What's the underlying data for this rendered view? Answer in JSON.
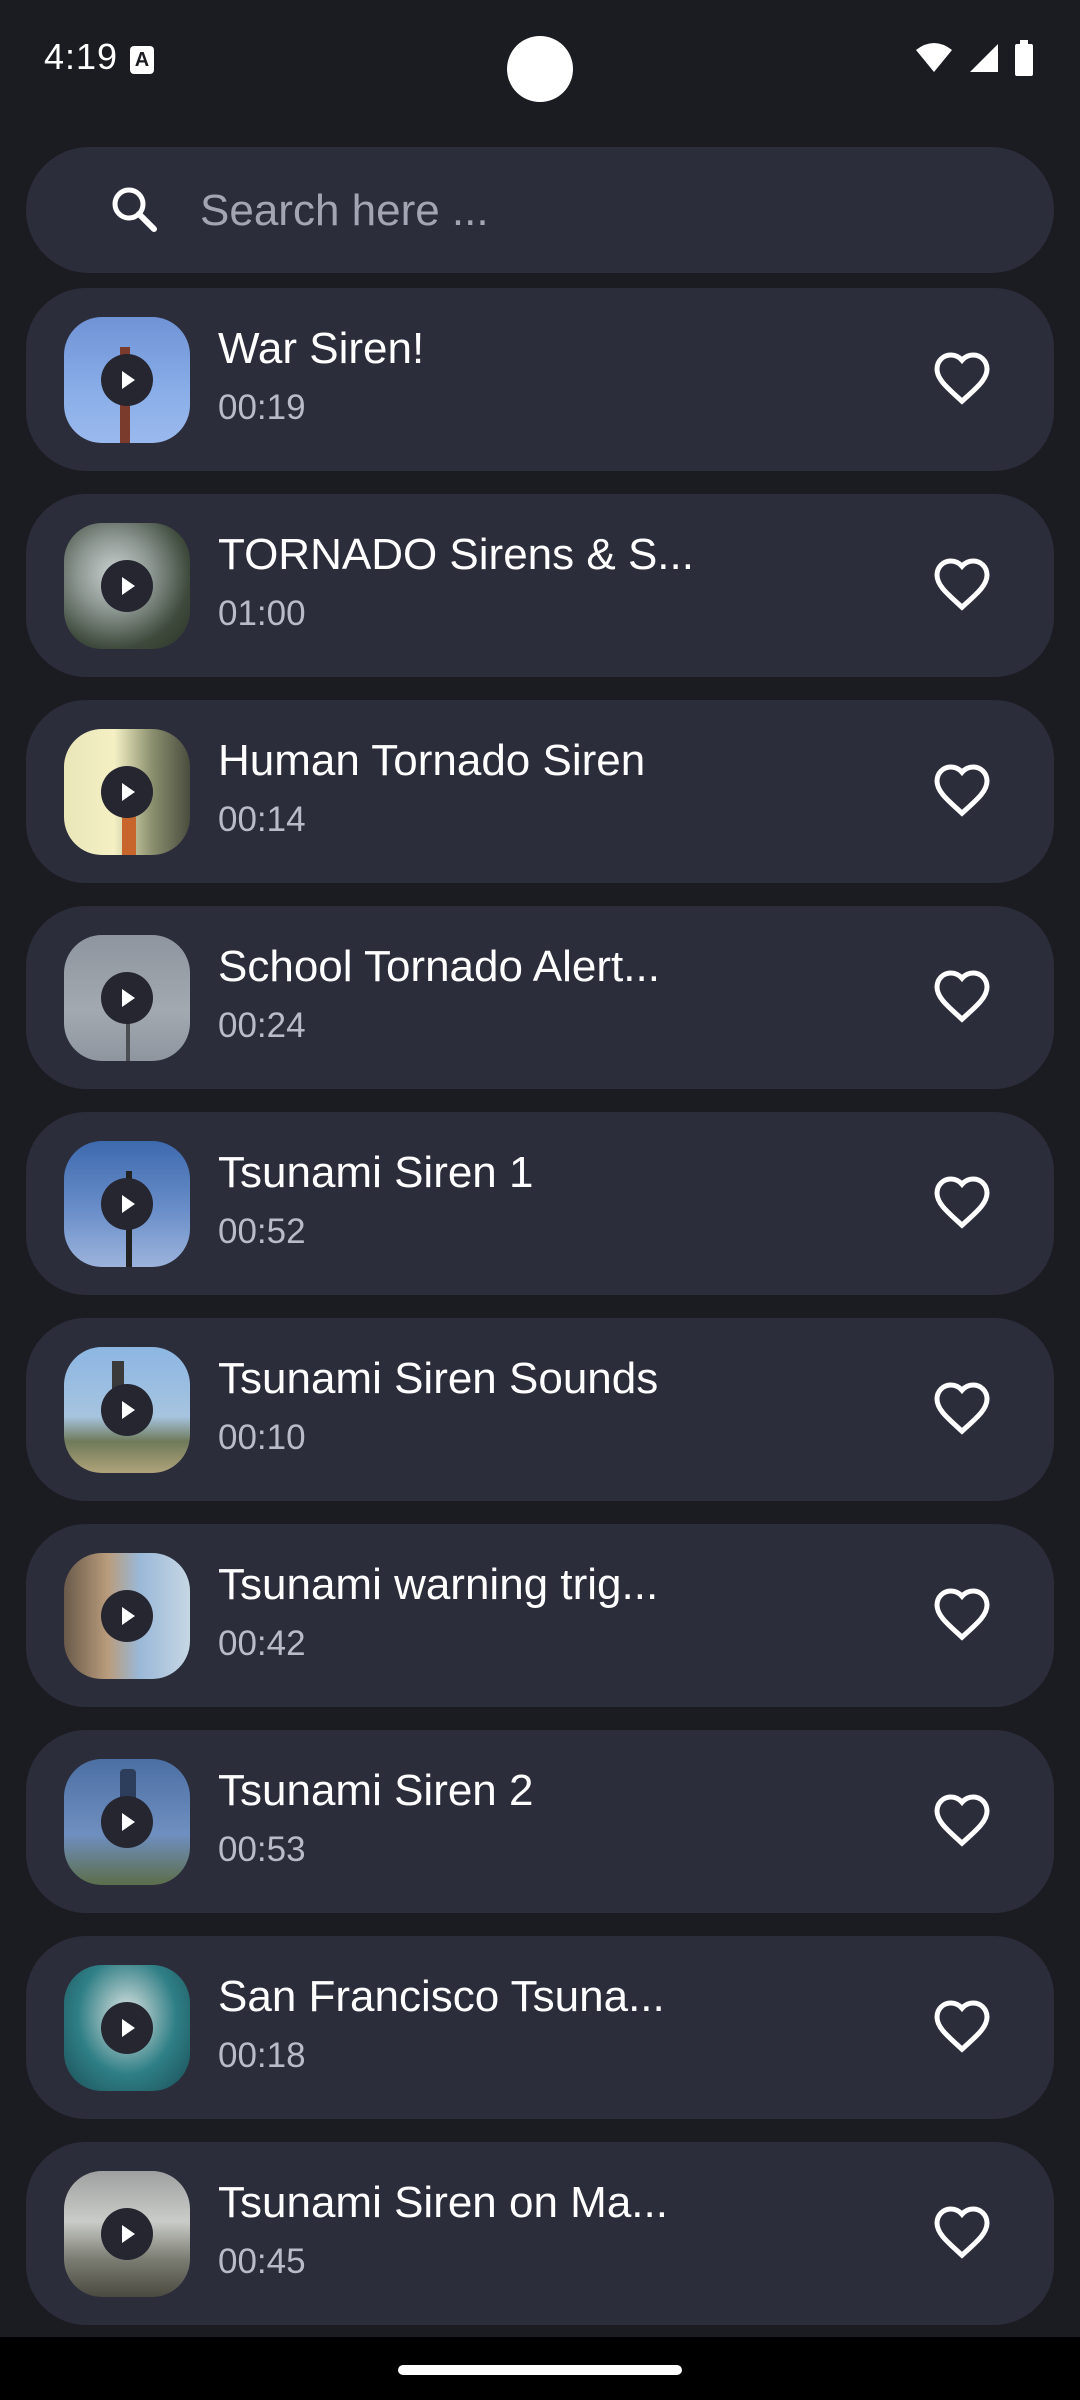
{
  "status_bar": {
    "time": "4:19",
    "notification_icon": "text-a-icon",
    "icons": [
      "wifi-icon",
      "cellular-signal-icon",
      "battery-icon"
    ]
  },
  "search": {
    "placeholder": "Search here ...",
    "value": "",
    "icon": "search-icon"
  },
  "items": [
    {
      "title": "War Siren!",
      "duration": "00:19",
      "favorited": false
    },
    {
      "title": "TORNADO Sirens & S...",
      "duration": "01:00",
      "favorited": false
    },
    {
      "title": "Human Tornado Siren",
      "duration": "00:14",
      "favorited": false
    },
    {
      "title": "School Tornado Alert...",
      "duration": "00:24",
      "favorited": false
    },
    {
      "title": "Tsunami Siren 1",
      "duration": "00:52",
      "favorited": false
    },
    {
      "title": "Tsunami Siren Sounds",
      "duration": "00:10",
      "favorited": false
    },
    {
      "title": "Tsunami warning trig...",
      "duration": "00:42",
      "favorited": false
    },
    {
      "title": "Tsunami Siren 2",
      "duration": "00:53",
      "favorited": false
    },
    {
      "title": "San Francisco Tsuna...",
      "duration": "00:18",
      "favorited": false
    },
    {
      "title": "Tsunami Siren on Ma...",
      "duration": "00:45",
      "favorited": false
    }
  ],
  "colors": {
    "background": "#1b1c22",
    "card": "#2b2d3b",
    "text_primary": "#ffffff",
    "text_secondary": "#b9bbc8",
    "placeholder": "#a3a5b3"
  }
}
